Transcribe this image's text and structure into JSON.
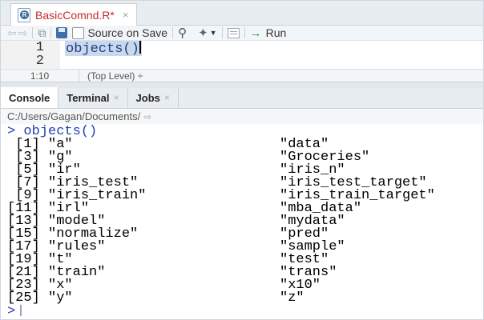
{
  "editor": {
    "tab_label": "BasicComnd.R*",
    "tab_close": "×",
    "toolbar": {
      "source_on_save_label": "Source on Save",
      "run_label": "Run"
    },
    "line_numbers": [
      "1",
      "2"
    ],
    "code_line_1": "objects()"
  },
  "status": {
    "position": "1:10",
    "scope": "(Top Level) ÷"
  },
  "console_tabs": [
    {
      "label": "Console",
      "close": ""
    },
    {
      "label": "Terminal",
      "close": "×"
    },
    {
      "label": "Jobs",
      "close": "×"
    }
  ],
  "console": {
    "path": "C:/Users/Gagan/Documents/",
    "prompt": ">",
    "command": "objects()",
    "rows": [
      {
        "index": " [1]",
        "left": "\"a\"",
        "right": "\"data\""
      },
      {
        "index": " [3]",
        "left": "\"g\"",
        "right": "\"Groceries\""
      },
      {
        "index": " [5]",
        "left": "\"ir\"",
        "right": "\"iris_n\""
      },
      {
        "index": " [7]",
        "left": "\"iris_test\"",
        "right": "\"iris_test_target\""
      },
      {
        "index": " [9]",
        "left": "\"iris_train\"",
        "right": "\"iris_train_target\""
      },
      {
        "index": "[11]",
        "left": "\"irl\"",
        "right": "\"mba_data\""
      },
      {
        "index": "[13]",
        "left": "\"model\"",
        "right": "\"mydata\""
      },
      {
        "index": "[15]",
        "left": "\"normalize\"",
        "right": "\"pred\""
      },
      {
        "index": "[17]",
        "left": "\"rules\"",
        "right": "\"sample\""
      },
      {
        "index": "[19]",
        "left": "\"t\"",
        "right": "\"test\""
      },
      {
        "index": "[21]",
        "left": "\"train\"",
        "right": "\"trans\""
      },
      {
        "index": "[23]",
        "left": "\"x\"",
        "right": "\"x10\""
      },
      {
        "index": "[25]",
        "left": "\"y\"",
        "right": "\"z\""
      }
    ]
  },
  "colors": {
    "tab_label": "#c32d2d",
    "console_command": "#1d3fb0",
    "selection": "#c9d8ee"
  }
}
